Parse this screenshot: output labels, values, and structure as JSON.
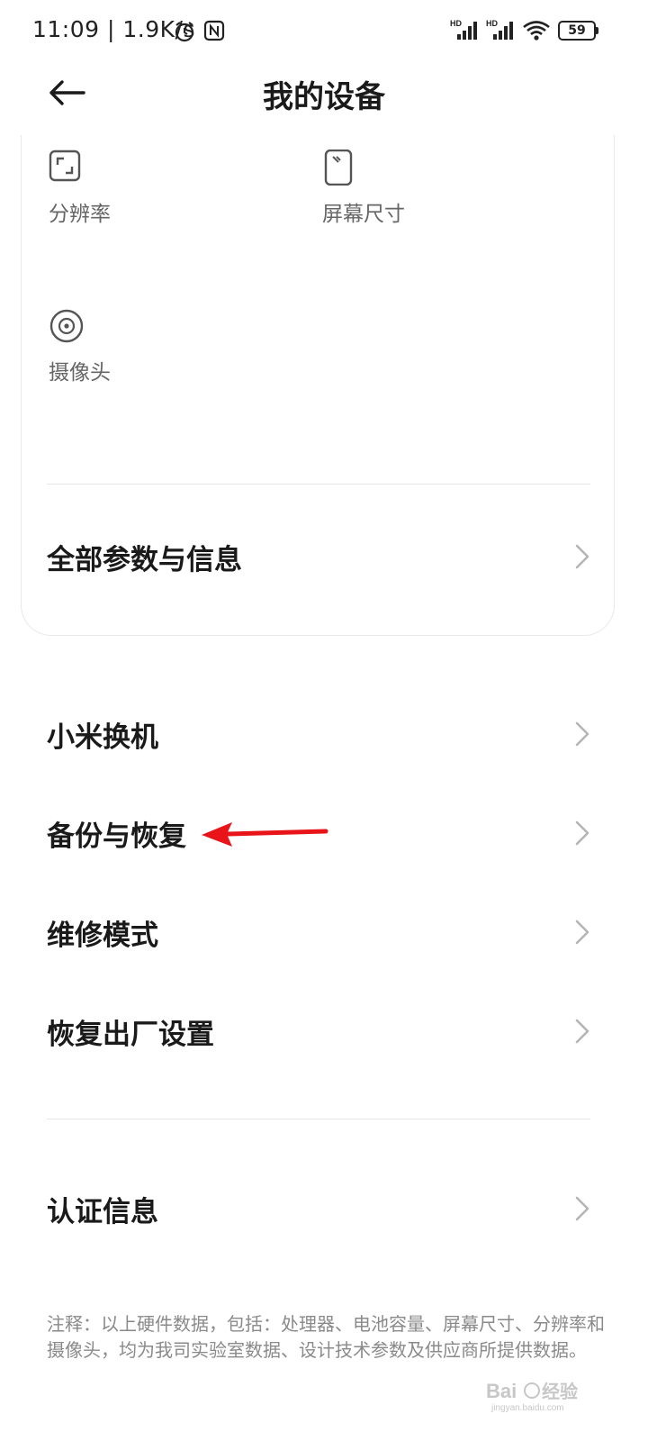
{
  "status_bar": {
    "time_speed": "11:09 | 1.9K/s",
    "battery": "59",
    "icons": [
      "alarm-icon",
      "nfc-icon",
      "hd-signal-icon",
      "hd-signal-icon",
      "wifi-icon",
      "battery-icon"
    ]
  },
  "header": {
    "title": "我的设备",
    "back_icon": "arrow-left-icon"
  },
  "specs": {
    "resolution_label": "分辨率",
    "screen_size_label": "屏幕尺寸",
    "camera_label": "摄像头",
    "all_params_label": "全部参数与信息"
  },
  "menu": {
    "items": [
      {
        "label": "小米换机"
      },
      {
        "label": "备份与恢复"
      },
      {
        "label": "维修模式"
      },
      {
        "label": "恢复出厂设置"
      },
      {
        "label": "认证信息"
      }
    ]
  },
  "footnote": "注释：以上硬件数据，包括：处理器、电池容量、屏幕尺寸、分辨率和摄像头，均为我司实验室数据、设计技术参数及供应商所提供数据。",
  "watermark_text": "Baidu经验 jingyan.baidu.com",
  "colors": {
    "annotation_arrow": "#e8141a",
    "primary_text": "#1a1a1a",
    "secondary_text": "#666666",
    "footnote_text": "#8a8a8a"
  }
}
